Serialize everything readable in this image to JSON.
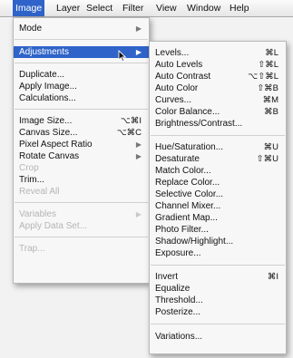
{
  "menubar": {
    "items": [
      {
        "label": "Image"
      },
      {
        "label": "Layer"
      },
      {
        "label": "Select"
      },
      {
        "label": "Filter"
      },
      {
        "label": "View"
      },
      {
        "label": "Window"
      },
      {
        "label": "Help"
      }
    ]
  },
  "image_menu": {
    "items": [
      {
        "label": "Mode",
        "shortcut": "",
        "submenu": true
      },
      {
        "label": "Adjustments",
        "shortcut": "",
        "submenu": true
      },
      {
        "label": "Duplicate...",
        "shortcut": ""
      },
      {
        "label": "Apply Image...",
        "shortcut": ""
      },
      {
        "label": "Calculations...",
        "shortcut": ""
      },
      {
        "label": "Image Size...",
        "shortcut": "⌥⌘I"
      },
      {
        "label": "Canvas Size...",
        "shortcut": "⌥⌘C"
      },
      {
        "label": "Pixel Aspect Ratio",
        "shortcut": "",
        "submenu": true
      },
      {
        "label": "Rotate Canvas",
        "shortcut": "",
        "submenu": true
      },
      {
        "label": "Crop",
        "shortcut": ""
      },
      {
        "label": "Trim...",
        "shortcut": ""
      },
      {
        "label": "Reveal All",
        "shortcut": ""
      },
      {
        "label": "Variables",
        "shortcut": "",
        "submenu": true
      },
      {
        "label": "Apply Data Set...",
        "shortcut": ""
      },
      {
        "label": "Trap...",
        "shortcut": ""
      }
    ]
  },
  "adjustments_menu": {
    "items": [
      {
        "label": "Levels...",
        "shortcut": "⌘L"
      },
      {
        "label": "Auto Levels",
        "shortcut": "⇧⌘L"
      },
      {
        "label": "Auto Contrast",
        "shortcut": "⌥⇧⌘L"
      },
      {
        "label": "Auto Color",
        "shortcut": "⇧⌘B"
      },
      {
        "label": "Curves...",
        "shortcut": "⌘M"
      },
      {
        "label": "Color Balance...",
        "shortcut": "⌘B"
      },
      {
        "label": "Brightness/Contrast...",
        "shortcut": ""
      },
      {
        "label": "Hue/Saturation...",
        "shortcut": "⌘U"
      },
      {
        "label": "Desaturate",
        "shortcut": "⇧⌘U"
      },
      {
        "label": "Match Color...",
        "shortcut": ""
      },
      {
        "label": "Replace Color...",
        "shortcut": ""
      },
      {
        "label": "Selective Color...",
        "shortcut": ""
      },
      {
        "label": "Channel Mixer...",
        "shortcut": ""
      },
      {
        "label": "Gradient Map...",
        "shortcut": ""
      },
      {
        "label": "Photo Filter...",
        "shortcut": ""
      },
      {
        "label": "Shadow/Highlight...",
        "shortcut": ""
      },
      {
        "label": "Exposure...",
        "shortcut": ""
      },
      {
        "label": "Invert",
        "shortcut": "⌘I"
      },
      {
        "label": "Equalize",
        "shortcut": ""
      },
      {
        "label": "Threshold...",
        "shortcut": ""
      },
      {
        "label": "Posterize...",
        "shortcut": ""
      },
      {
        "label": "Variations...",
        "shortcut": ""
      }
    ]
  },
  "colors": {
    "highlight": "#2f63c9",
    "disabled_text": "#b5b5b5"
  }
}
